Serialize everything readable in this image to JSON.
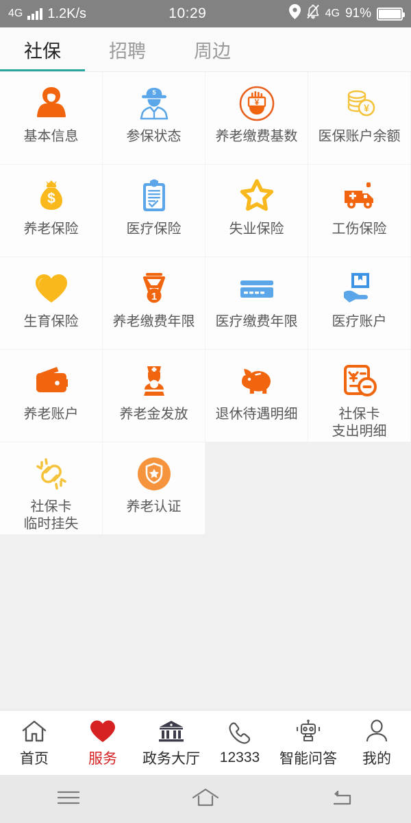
{
  "status_bar": {
    "network_left": "4G",
    "signal_icon": "signal-bars-icon",
    "speed": "1.2K/s",
    "time": "10:29",
    "location_icon": "location-pin-icon",
    "mute_icon": "bell-muted-icon",
    "network_right": "4G",
    "battery_percent": "91%",
    "battery_icon": "battery-icon"
  },
  "tabs": [
    {
      "label": "社保",
      "active": true
    },
    {
      "label": "招聘",
      "active": false
    },
    {
      "label": "周边",
      "active": false
    }
  ],
  "accent": {
    "tab_underline": "#26a8a0",
    "orange": "#f2650f",
    "orange_light": "#f5821f",
    "yellow": "#f9b91d",
    "blue": "#5ba6e8",
    "red": "#d62222"
  },
  "grid": [
    {
      "label": "基本信息",
      "icon": "person-orange-icon"
    },
    {
      "label": "参保状态",
      "icon": "worker-cap-icon"
    },
    {
      "label": "养老缴费基数",
      "icon": "yuan-hand-circle-icon"
    },
    {
      "label": "医保账户余额",
      "icon": "coins-yuan-icon"
    },
    {
      "label": "养老保险",
      "icon": "money-bag-icon"
    },
    {
      "label": "医疗保险",
      "icon": "clipboard-check-icon"
    },
    {
      "label": "失业保险",
      "icon": "star-icon"
    },
    {
      "label": "工伤保险",
      "icon": "ambulance-icon"
    },
    {
      "label": "生育保险",
      "icon": "heart-icon"
    },
    {
      "label": "养老缴费年限",
      "icon": "medal-icon"
    },
    {
      "label": "医疗缴费年限",
      "icon": "credit-card-icon"
    },
    {
      "label": "医疗账户",
      "icon": "hand-box-icon"
    },
    {
      "label": "养老账户",
      "icon": "wallet-icon"
    },
    {
      "label": "养老金发放",
      "icon": "nurse-icon"
    },
    {
      "label": "退休待遇明细",
      "icon": "piggy-bank-icon"
    },
    {
      "label": "社保卡\n支出明细",
      "icon": "yuan-doc-minus-icon"
    },
    {
      "label": "社保卡\n临时挂失",
      "icon": "broken-link-icon"
    },
    {
      "label": "养老认证",
      "icon": "shield-badge-icon"
    }
  ],
  "bottom_nav": [
    {
      "label": "首页",
      "icon": "home-icon",
      "active": false
    },
    {
      "label": "服务",
      "icon": "heart-filled-icon",
      "active": true
    },
    {
      "label": "政务大厅",
      "icon": "bank-icon",
      "active": false
    },
    {
      "label": "12333",
      "icon": "phone-icon",
      "active": false
    },
    {
      "label": "智能问答",
      "icon": "robot-icon",
      "active": false
    },
    {
      "label": "我的",
      "icon": "person-outline-icon",
      "active": false
    }
  ],
  "android_nav": [
    {
      "icon": "menu-icon"
    },
    {
      "icon": "home-outline-icon"
    },
    {
      "icon": "back-icon"
    }
  ]
}
